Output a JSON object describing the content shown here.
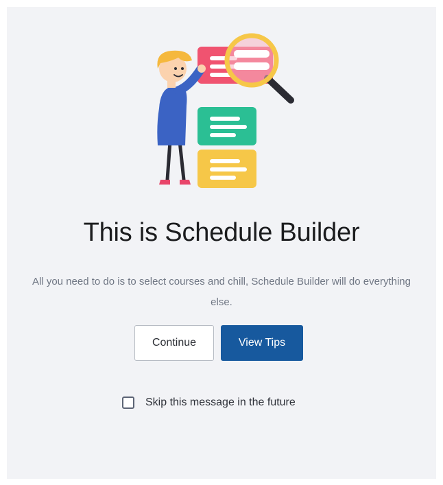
{
  "dialog": {
    "title": "This is Schedule Builder",
    "description": "All you need to do is to select courses and chill, Schedule Builder will do everything else.",
    "continue_label": "Continue",
    "view_tips_label": "View Tips",
    "skip_label": "Skip this message in the future",
    "skip_checked": false
  },
  "illustration": {
    "name": "person-inspecting-cards-illustration",
    "colors": {
      "red_card": "#f05370",
      "green_card": "#2bbf94",
      "yellow_card": "#f6c748",
      "magnifier_ring": "#f6c748",
      "magnifier_handle": "#2b2b33",
      "shirt": "#3b63c4",
      "hair": "#f5b83d"
    }
  },
  "colors": {
    "panel_background": "#f2f3f6",
    "primary_button": "#17599e",
    "title_text": "#1b1c1e",
    "description_text": "#707784"
  }
}
